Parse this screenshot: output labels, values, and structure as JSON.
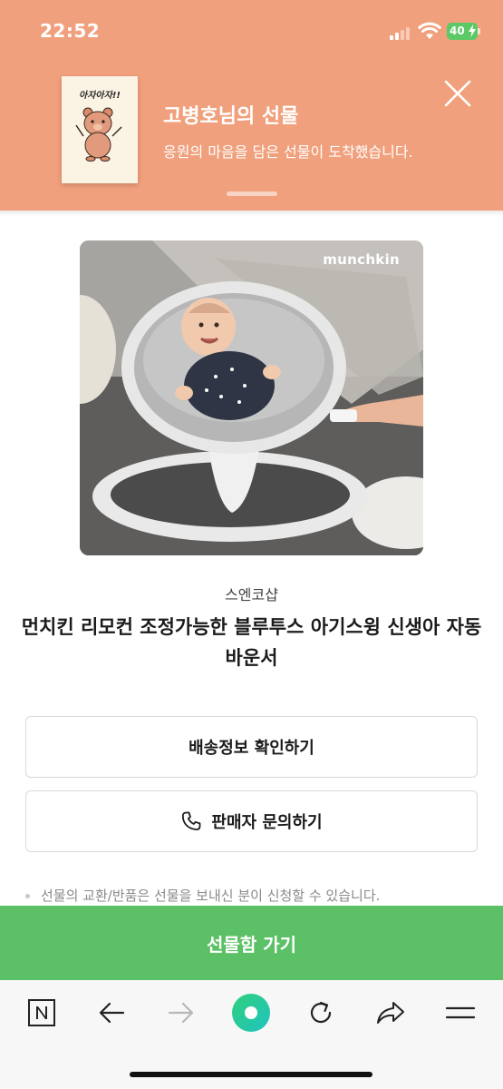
{
  "status": {
    "time": "22:52",
    "battery": "40"
  },
  "gift": {
    "card_text": "아자아자!!",
    "title": "고병호님의 선물",
    "subtitle": "응원의 마음을 담은 선물이 도착했습니다."
  },
  "product": {
    "brand_logo": "munchkin",
    "seller": "스엔코샵",
    "name": "먼치킨 리모컨 조정가능한 블루투스 아기스윙 신생아 자동 바운서"
  },
  "buttons": {
    "shipping": "배송정보 확인하기",
    "inquiry": "판매자 문의하기"
  },
  "notice": "선물의 교환/반품은 선물을 보내신 분이 신청할 수 있습니다.",
  "cta": "선물함 가기",
  "colors": {
    "header_bg": "#f0a07c",
    "cta_green": "#5cc166",
    "battery_green": "#5cc966"
  },
  "toolbar": {
    "icons": [
      "naver-n-icon",
      "back-arrow-icon",
      "forward-arrow-icon",
      "home-circle-icon",
      "refresh-icon",
      "share-icon",
      "menu-icon"
    ]
  }
}
